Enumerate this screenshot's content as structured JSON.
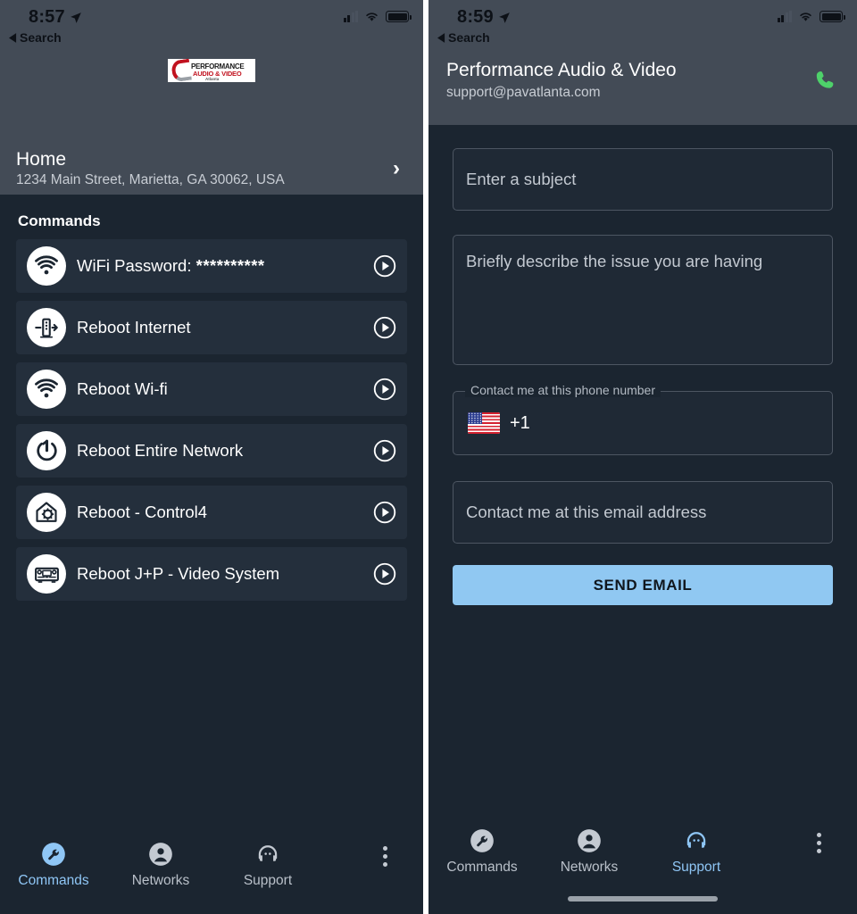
{
  "left": {
    "status": {
      "time": "8:57",
      "back_label": "Search",
      "location_icon": "location-arrow-icon"
    },
    "logo": {
      "line1": "PERFORMANCE",
      "line2": "AUDIO & VIDEO",
      "line3": "Atlanta"
    },
    "home": {
      "title": "Home",
      "address": "1234 Main Street, Marietta, GA 30062, USA",
      "chevron": "›"
    },
    "section_title": "Commands",
    "commands": [
      {
        "label": "WiFi Password:",
        "value": "**********",
        "icon": "wifi-icon"
      },
      {
        "label": "Reboot Internet",
        "value": "",
        "icon": "router-icon"
      },
      {
        "label": "Reboot Wi-fi",
        "value": "",
        "icon": "wifi-icon"
      },
      {
        "label": "Reboot Entire Network",
        "value": "",
        "icon": "power-icon"
      },
      {
        "label": "Reboot - Control4",
        "value": "",
        "icon": "home-gear-icon"
      },
      {
        "label": "Reboot J+P - Video System",
        "value": "",
        "icon": "av-receiver-icon"
      }
    ],
    "nav": [
      {
        "label": "Commands",
        "icon": "wrench-icon",
        "active": true
      },
      {
        "label": "Networks",
        "icon": "person-icon",
        "active": false
      },
      {
        "label": "Support",
        "icon": "headset-icon",
        "active": false
      }
    ],
    "overflow_icon": "kebab-menu-icon"
  },
  "right": {
    "status": {
      "time": "8:59",
      "back_label": "Search",
      "location_icon": "location-arrow-icon"
    },
    "header": {
      "title": "Performance Audio & Video",
      "email": "support@pavatlanta.com",
      "call_icon": "phone-icon"
    },
    "form": {
      "subject_placeholder": "Enter a subject",
      "description_placeholder": "Briefly describe the issue you are having",
      "phone_label": "Contact me at this phone number",
      "phone_country_flag": "us-flag-icon",
      "phone_country_code": "+1",
      "email_placeholder": "Contact me at this email address",
      "send_label": "SEND EMAIL"
    },
    "nav": [
      {
        "label": "Commands",
        "icon": "wrench-icon",
        "active": false
      },
      {
        "label": "Networks",
        "icon": "person-icon",
        "active": false
      },
      {
        "label": "Support",
        "icon": "headset-icon",
        "active": true
      }
    ],
    "overflow_icon": "kebab-menu-icon"
  },
  "colors": {
    "header_gray": "#434b56",
    "body_dark": "#1b2530",
    "card_dark": "#242f3c",
    "accent_blue": "#8fc6f5",
    "send_button": "#90c8f2",
    "phone_green": "#4ed16a",
    "logo_red": "#c1121f"
  }
}
